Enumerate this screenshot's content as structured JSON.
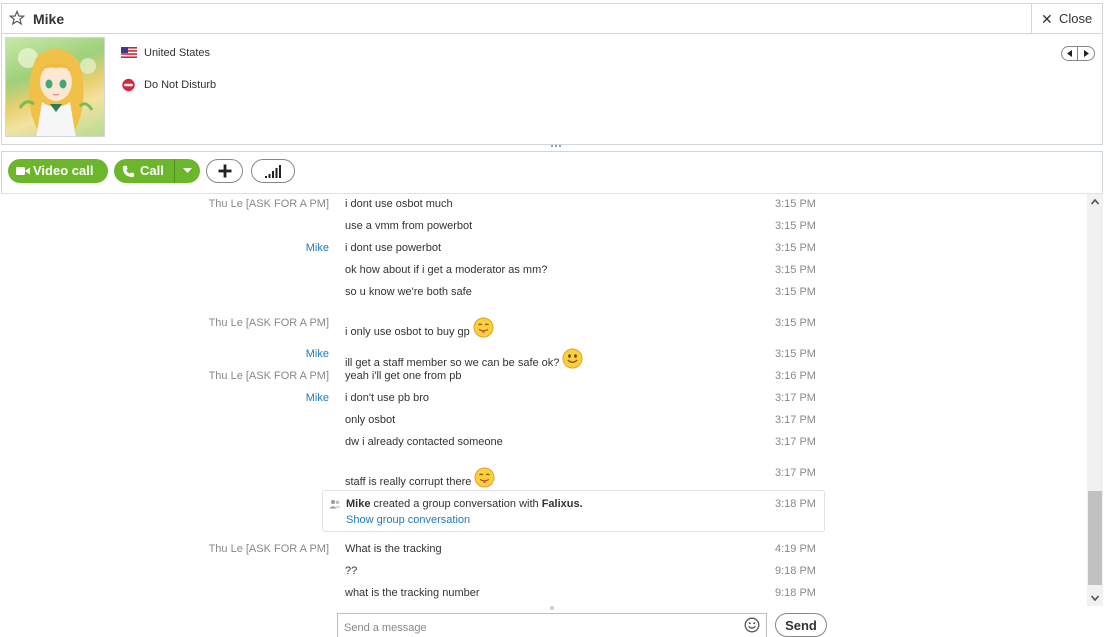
{
  "window": {
    "title": "Mike",
    "close_label": "Close"
  },
  "profile": {
    "location": "United States",
    "status": "Do Not Disturb"
  },
  "toolbar": {
    "video_call_label": "Video call",
    "call_label": "Call"
  },
  "messages": [
    {
      "sender": "Thu Le [ASK FOR A PM]",
      "text": "i dont use osbot much",
      "time": "3:15 PM"
    },
    {
      "sender": "",
      "text": "use a vmm from powerbot",
      "time": "3:15 PM"
    },
    {
      "sender": "Mike",
      "text": "i dont use powerbot",
      "time": "3:15 PM"
    },
    {
      "sender": "",
      "text": "ok how about if i get a moderator as mm?",
      "time": "3:15 PM"
    },
    {
      "sender": "",
      "text": "so u know we're both safe",
      "time": "3:15 PM"
    },
    {
      "sender": "Thu Le [ASK FOR A PM]",
      "text": "i only use osbot to buy gp",
      "time": "3:15 PM",
      "emoticon": "tongue-out"
    },
    {
      "sender": "Mike",
      "text": "ill get a staff member so we can be safe ok?",
      "time": "3:15 PM",
      "emoticon": "smile"
    },
    {
      "sender": "Thu Le [ASK FOR A PM]",
      "text": "yeah i'll get one from pb",
      "time": "3:16 PM"
    },
    {
      "sender": "Mike",
      "text": "i don't use pb bro",
      "time": "3:17 PM"
    },
    {
      "sender": "",
      "text": "only osbot",
      "time": "3:17 PM"
    },
    {
      "sender": "",
      "text": "dw i already contacted someone",
      "time": "3:17 PM"
    },
    {
      "sender": "",
      "text": "staff is really corrupt there",
      "time": "3:17 PM",
      "emoticon": "tongue-out"
    }
  ],
  "group_event": {
    "actor": "Mike",
    "text": "created a group conversation with",
    "target": "Falixus.",
    "link": "Show group conversation",
    "time": "3:18 PM"
  },
  "messages_after": [
    {
      "sender": "Thu Le [ASK FOR A PM]",
      "text": "What is the tracking",
      "time": "4:19 PM"
    },
    {
      "sender": "",
      "text": "??",
      "time": "9:18 PM"
    },
    {
      "sender": "",
      "text": "what is the tracking number",
      "time": "9:18 PM"
    }
  ],
  "composer": {
    "placeholder": "Send a message",
    "send_label": "Send"
  },
  "colors": {
    "accent_green": "#6cb62b",
    "link_blue": "#1e7ac2",
    "dnd_red": "#d7263d"
  }
}
